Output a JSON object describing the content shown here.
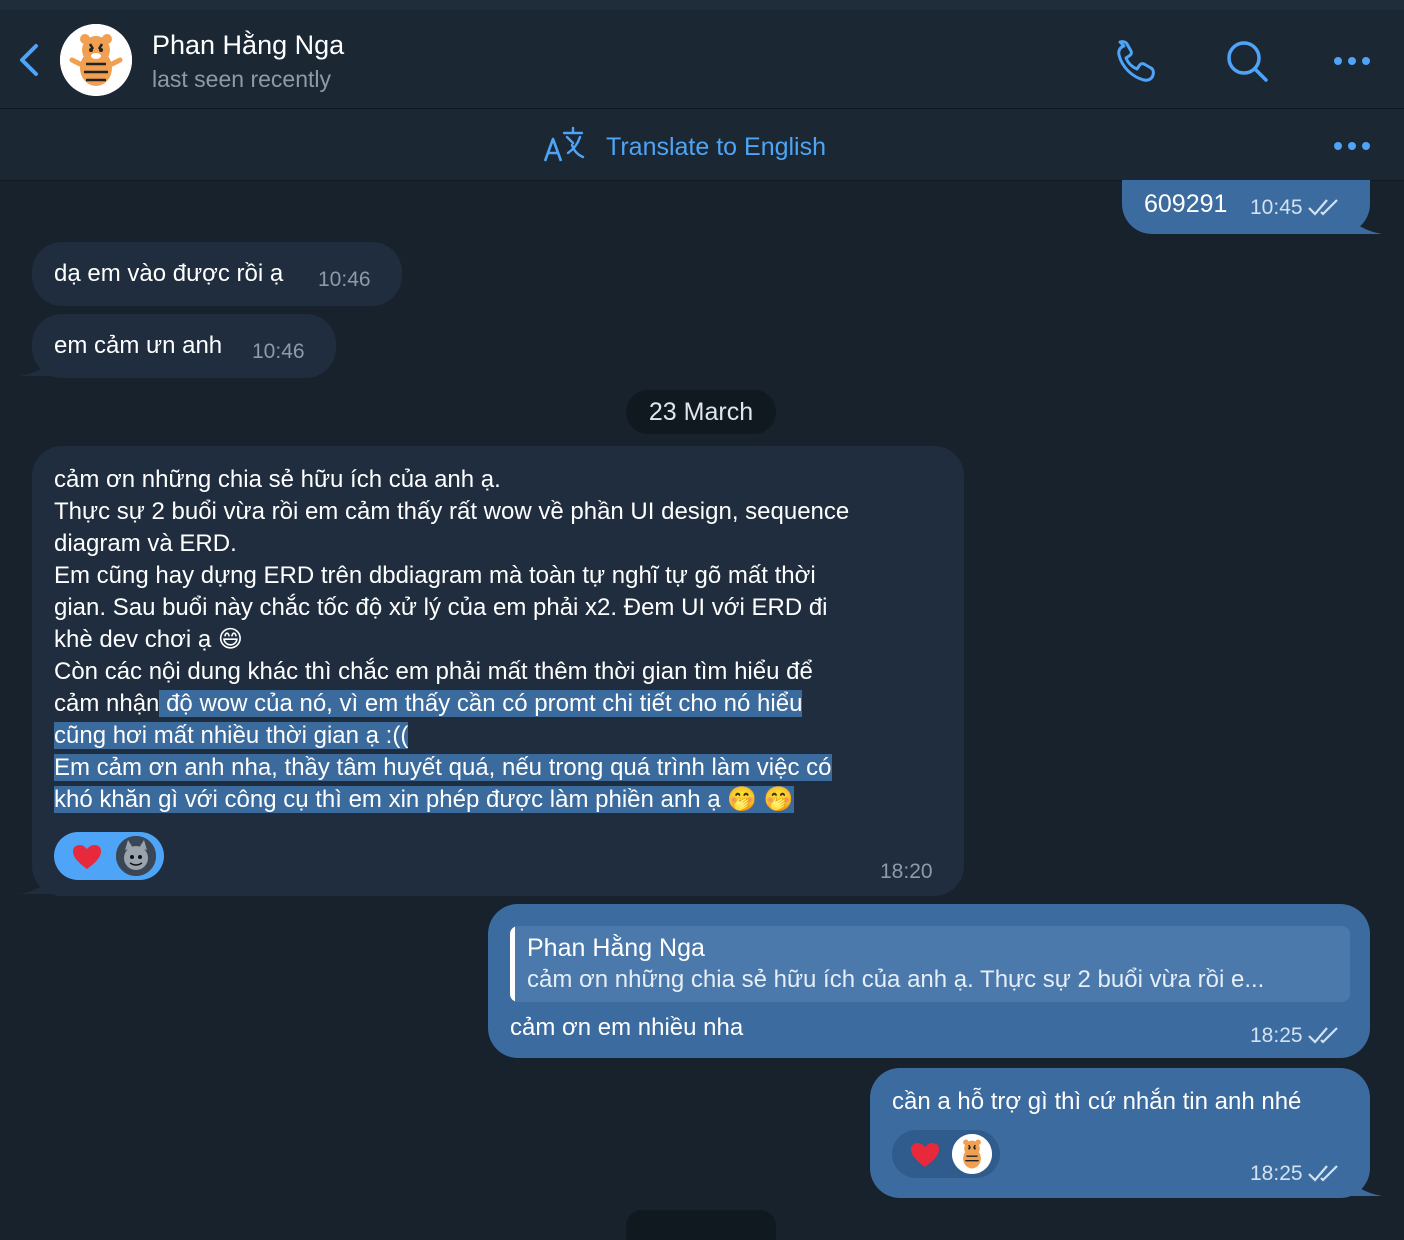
{
  "header": {
    "contact_name": "Phan Hằng Nga",
    "status": "last seen recently",
    "back_icon": "chevron-left-icon",
    "call_icon": "phone-icon",
    "search_icon": "search-icon",
    "more_icon": "more-horizontal-icon"
  },
  "translate": {
    "label": "Translate to English",
    "icon": "translate-icon"
  },
  "messages": [
    {
      "text": "609291",
      "time": "10:45",
      "direction": "out"
    },
    {
      "text": "dạ em vào được rồi ạ",
      "time": "10:46",
      "direction": "in"
    },
    {
      "text": "em cảm ưn anh",
      "time": "10:46",
      "direction": "in"
    }
  ],
  "date_divider": "23 March",
  "long_message": {
    "line1": "cảm ơn những chia sẻ hữu ích của anh ạ.",
    "line2": "Thực sự 2 buổi vừa rồi em cảm thấy rất wow về phần UI design, sequence",
    "line3": "diagram và ERD.",
    "line4": "Em cũng hay dựng ERD trên dbdiagram mà toàn tự nghĩ tự gõ mất thời",
    "line5": "gian. Sau buổi này chắc tốc độ xử lý của em phải x2. Đem UI với ERD đi",
    "line6": "khè dev chơi ạ 😄",
    "line7": "Còn các nội dung khác thì chắc em phải mất thêm thời gian tìm hiểu để",
    "line8a": "cảm nhận",
    "line8b": " độ wow của nó, vì em thấy cần có promt chi tiết cho nó hiểu",
    "line9": "cũng hơi mất nhiều thời gian ạ :((",
    "line10": "Em cảm ơn anh nha, thầy tâm huyết quá, nếu trong quá trình làm việc có",
    "line11": "khó khăn gì với công cụ thì em xin phép được làm phiền anh ạ 🤭 🤭",
    "time": "18:20",
    "reaction": "heart"
  },
  "reply_message": {
    "quote_name": "Phan Hằng Nga",
    "quote_text": "cảm ơn những chia sẻ hữu ích của anh ạ. Thực sự 2 buổi vừa rồi e...",
    "text": "cảm ơn em nhiều nha",
    "time": "18:25"
  },
  "last_message": {
    "text": "cần a hỗ trợ gì thì cứ nhắn tin anh nhé",
    "time": "18:25",
    "reaction": "heart"
  },
  "colors": {
    "background": "#18222d",
    "header": "#1c2734",
    "incoming": "#1f2d3e",
    "outgoing": "#3c6b9f",
    "accent": "#4ea4f6",
    "heart": "#e8283b"
  }
}
